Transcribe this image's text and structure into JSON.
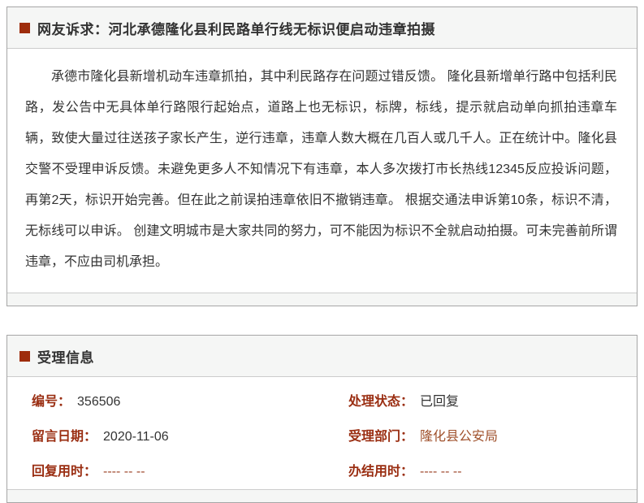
{
  "complaint": {
    "title": "网友诉求：河北承德隆化县利民路单行线无标识便启动违章拍摄",
    "body": "承德市隆化县新增机动车违章抓拍，其中利民路存在问题过错反馈。 隆化县新增单行路中包括利民路，发公告中无具体单行路限行起始点，道路上也无标识，标牌，标线，提示就启动单向抓拍违章车辆，致使大量过往送孩子家长产生，逆行违章，违章人数大概在几百人或几千人。正在统计中。隆化县交警不受理申诉反馈。未避免更多人不知情况下有违章，本人多次拨打市长热线12345反应投诉问题，再第2天，标识开始完善。但在此之前误拍违章依旧不撤销违章。 根据交通法申诉第10条，标识不清，无标线可以申诉。 创建文明城市是大家共同的努力，可不能因为标识不全就启动拍摄。可未完善前所谓违章，不应由司机承担。"
  },
  "acceptance": {
    "title": "受理信息",
    "fields": [
      {
        "label": "编号：",
        "value": "356506"
      },
      {
        "label": "处理状态：",
        "value": "已回复"
      },
      {
        "label": "留言日期：",
        "value": "2020-11-06"
      },
      {
        "label": "受理部门：",
        "value": "隆化县公安局"
      },
      {
        "label": "回复用时：",
        "value": "---- -- --"
      },
      {
        "label": "办结用时：",
        "value": "---- -- --"
      }
    ]
  },
  "colors": {
    "accent_bullet": "#9e2d0c",
    "label": "#9a2e12",
    "department_link": "#a0522d",
    "body_text": "#333333",
    "header_bg": "#f5f6f5",
    "box_border": "#a6a6a6"
  }
}
